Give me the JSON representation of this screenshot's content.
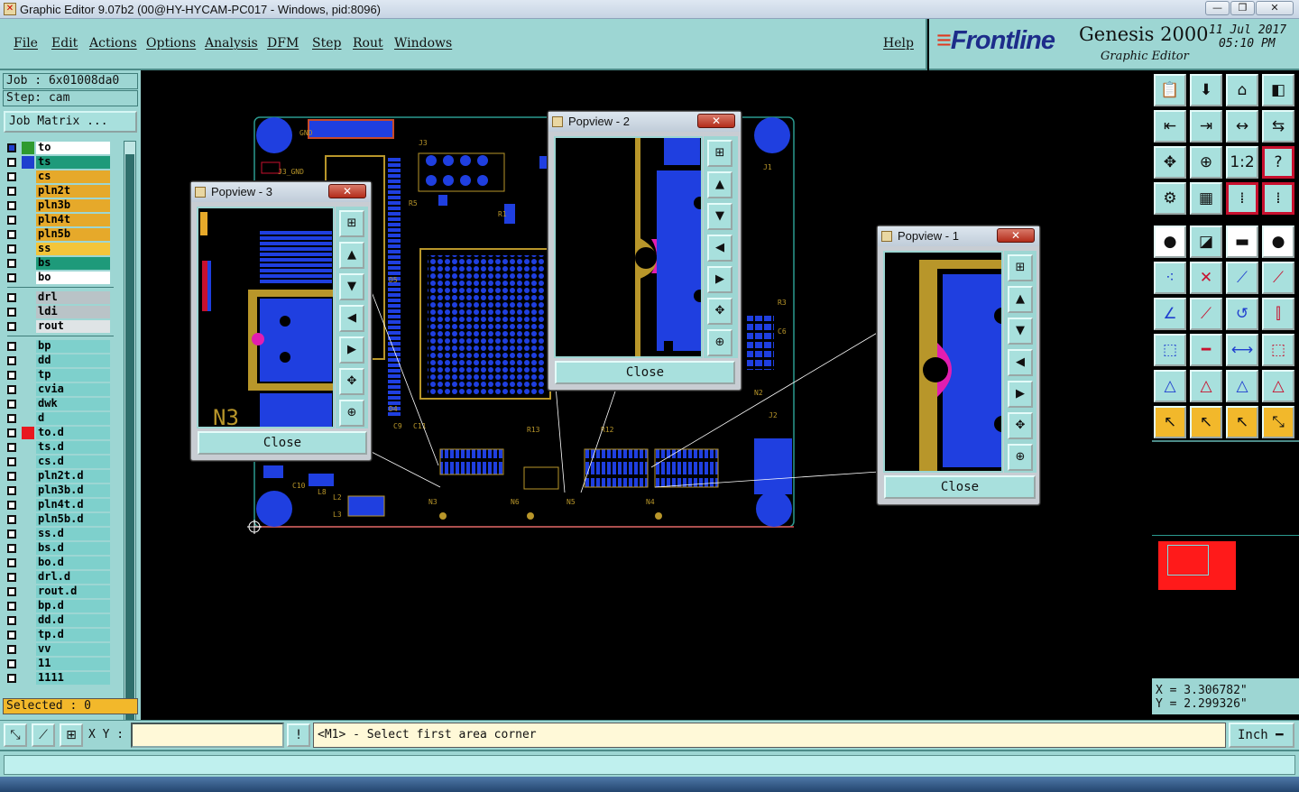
{
  "window": {
    "title": "Graphic Editor 9.07b2 (00@HY-HYCAM-PC017 - Windows, pid:8096)",
    "minimize": "—",
    "maximize": "❐",
    "close": "✕"
  },
  "menu": {
    "file": "File",
    "edit": "Edit",
    "actions": "Actions",
    "options": "Options",
    "analysis": "Analysis",
    "dfm": "DFM",
    "step": "Step",
    "rout": "Rout",
    "windows": "Windows",
    "help": "Help"
  },
  "brand": {
    "logo": "Frontline",
    "product": "Genesis 2000",
    "subtitle": "Graphic Editor",
    "date": "11 Jul 2017",
    "time": "05:10 PM"
  },
  "left": {
    "job": "Job : 6x01008da0",
    "step": "Step: cam",
    "job_matrix": "Job Matrix ...",
    "selected": "Selected : 0",
    "layers": [
      {
        "name": "to",
        "swatch": "#2f9a2f",
        "bg": "#ffffff",
        "cb": "#1f3fcf"
      },
      {
        "name": "ts",
        "swatch": "#1f3fcf",
        "bg": "#1e9a7a",
        "cb": "#ffffff"
      },
      {
        "name": "cs",
        "swatch": "",
        "bg": "#e6a92a",
        "cb": "#ffffff"
      },
      {
        "name": "pln2t",
        "swatch": "",
        "bg": "#e6a92a",
        "cb": "#ffffff"
      },
      {
        "name": "pln3b",
        "swatch": "",
        "bg": "#e6a92a",
        "cb": "#ffffff"
      },
      {
        "name": "pln4t",
        "swatch": "",
        "bg": "#e6a92a",
        "cb": "#ffffff"
      },
      {
        "name": "pln5b",
        "swatch": "",
        "bg": "#e6a92a",
        "cb": "#ffffff"
      },
      {
        "name": "ss",
        "swatch": "",
        "bg": "#f3c53a",
        "cb": "#ffffff"
      },
      {
        "name": "bs",
        "swatch": "",
        "bg": "#1e9a7a",
        "cb": "#ffffff"
      },
      {
        "name": "bo",
        "swatch": "",
        "bg": "#ffffff",
        "cb": "#ffffff"
      },
      {
        "name": "drl",
        "swatch": "",
        "bg": "#b9c3c7",
        "cb": "#ffffff"
      },
      {
        "name": "ldi",
        "swatch": "",
        "bg": "#b9c3c7",
        "cb": "#ffffff"
      },
      {
        "name": "rout",
        "swatch": "",
        "bg": "#dfe4e6",
        "cb": "#ffffff"
      },
      {
        "name": "bp",
        "swatch": "",
        "bg": "#7ed0cc",
        "cb": "#ffffff"
      },
      {
        "name": "dd",
        "swatch": "",
        "bg": "#7ed0cc",
        "cb": "#ffffff"
      },
      {
        "name": "tp",
        "swatch": "",
        "bg": "#7ed0cc",
        "cb": "#ffffff"
      },
      {
        "name": "cvia",
        "swatch": "",
        "bg": "#7ed0cc",
        "cb": "#ffffff"
      },
      {
        "name": "dwk",
        "swatch": "",
        "bg": "#7ed0cc",
        "cb": "#ffffff"
      },
      {
        "name": "d",
        "swatch": "",
        "bg": "#7ed0cc",
        "cb": "#ffffff"
      },
      {
        "name": "to.d",
        "swatch": "#e8181f",
        "bg": "#7ed0cc",
        "cb": "#ffffff"
      },
      {
        "name": "ts.d",
        "swatch": "",
        "bg": "#7ed0cc",
        "cb": "#ffffff"
      },
      {
        "name": "cs.d",
        "swatch": "",
        "bg": "#7ed0cc",
        "cb": "#ffffff"
      },
      {
        "name": "pln2t.d",
        "swatch": "",
        "bg": "#7ed0cc",
        "cb": "#ffffff"
      },
      {
        "name": "pln3b.d",
        "swatch": "",
        "bg": "#7ed0cc",
        "cb": "#ffffff"
      },
      {
        "name": "pln4t.d",
        "swatch": "",
        "bg": "#7ed0cc",
        "cb": "#ffffff"
      },
      {
        "name": "pln5b.d",
        "swatch": "",
        "bg": "#7ed0cc",
        "cb": "#ffffff"
      },
      {
        "name": "ss.d",
        "swatch": "",
        "bg": "#7ed0cc",
        "cb": "#ffffff"
      },
      {
        "name": "bs.d",
        "swatch": "",
        "bg": "#7ed0cc",
        "cb": "#ffffff"
      },
      {
        "name": "bo.d",
        "swatch": "",
        "bg": "#7ed0cc",
        "cb": "#ffffff"
      },
      {
        "name": "drl.d",
        "swatch": "",
        "bg": "#7ed0cc",
        "cb": "#ffffff"
      },
      {
        "name": "rout.d",
        "swatch": "",
        "bg": "#7ed0cc",
        "cb": "#ffffff"
      },
      {
        "name": "bp.d",
        "swatch": "",
        "bg": "#7ed0cc",
        "cb": "#ffffff"
      },
      {
        "name": "dd.d",
        "swatch": "",
        "bg": "#7ed0cc",
        "cb": "#ffffff"
      },
      {
        "name": "tp.d",
        "swatch": "",
        "bg": "#7ed0cc",
        "cb": "#ffffff"
      },
      {
        "name": "vv",
        "swatch": "",
        "bg": "#7ed0cc",
        "cb": "#ffffff"
      },
      {
        "name": "11",
        "swatch": "",
        "bg": "#7ed0cc",
        "cb": "#ffffff"
      },
      {
        "name": "1111",
        "swatch": "",
        "bg": "#7ed0cc",
        "cb": "#ffffff"
      }
    ]
  },
  "popviews": [
    {
      "title": "Popview - 3",
      "close": "Close",
      "close_x": "✕"
    },
    {
      "title": "Popview - 2",
      "close": "Close",
      "close_x": "✕"
    },
    {
      "title": "Popview - 1",
      "close": "Close",
      "close_x": "✕"
    }
  ],
  "board_labels": [
    "J3",
    "J2",
    "D5",
    "D4",
    "N3",
    "N6",
    "N5",
    "N4",
    "N2",
    "C10",
    "L8",
    "L2",
    "L3",
    "R5",
    "R1",
    "R3",
    "C6",
    "C9",
    "C11",
    "R13",
    "R12",
    "J1",
    "GND",
    "J3_GND"
  ],
  "popview3_label": "N3",
  "coords": {
    "x": "X = 3.306782\"",
    "y": "Y = 2.299326\""
  },
  "status": {
    "xy_label": "X Y :",
    "xy_value": "",
    "message": "<M1> - Select first area corner",
    "unit": "Inch ━",
    "excl": "!"
  },
  "tools": [
    "📋",
    "⬇",
    "⌂",
    "◧",
    "⇤",
    "⇥",
    "↔",
    "⇆",
    "✥",
    "⊕",
    "1:2",
    "?",
    "⚙",
    "▦",
    "⁞",
    "⁞",
    "●",
    "◪",
    "▬",
    "●",
    "⁖",
    "✕",
    "⟋",
    "⟋",
    "∠",
    "⟋",
    "↺",
    "⫿",
    "⬚",
    "━",
    "⟷",
    "⬚",
    "△",
    "△",
    "△",
    "△",
    "↖",
    "↖",
    "↖",
    "⤡"
  ]
}
